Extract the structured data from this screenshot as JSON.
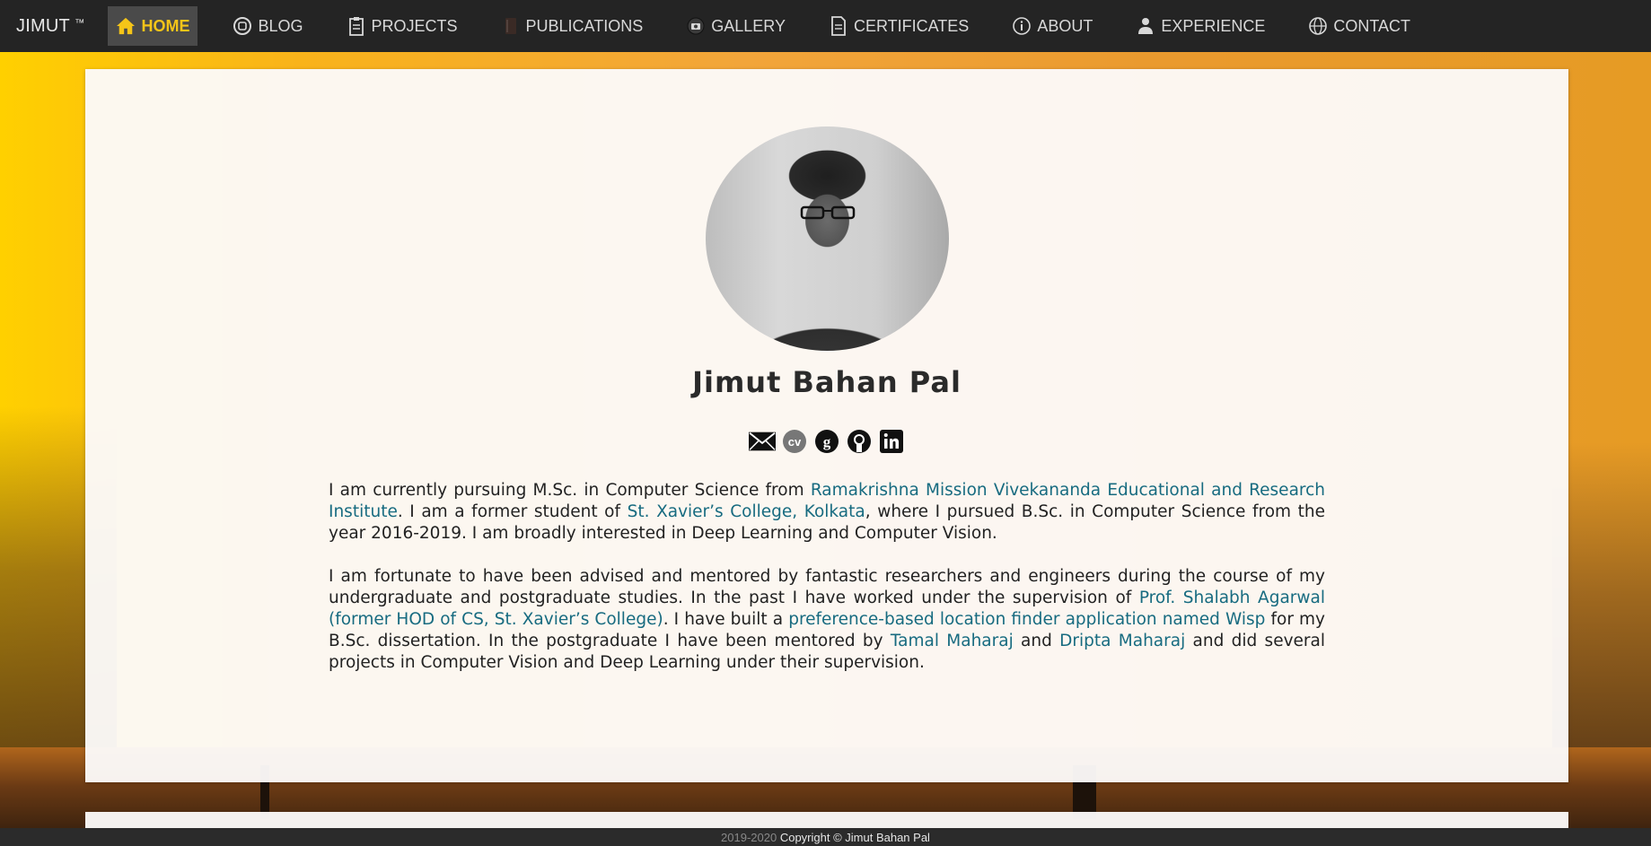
{
  "nav": {
    "brand": "JIMUT",
    "brand_tm": "™",
    "items": [
      {
        "label": "HOME",
        "icon": "home-icon",
        "active": true
      },
      {
        "label": "BLOG",
        "icon": "blogger-icon"
      },
      {
        "label": "PROJECTS",
        "icon": "clipboard-icon"
      },
      {
        "label": "PUBLICATIONS",
        "icon": "book-icon"
      },
      {
        "label": "GALLERY",
        "icon": "camera-icon"
      },
      {
        "label": "CERTIFICATES",
        "icon": "document-icon"
      },
      {
        "label": "ABOUT",
        "icon": "info-icon"
      },
      {
        "label": "EXPERIENCE",
        "icon": "person-icon"
      },
      {
        "label": "CONTACT",
        "icon": "globe-icon"
      }
    ]
  },
  "profile": {
    "name": "Jimut Bahan Pal",
    "social": [
      "email-icon",
      "cv-icon",
      "google-scholar-icon",
      "github-icon",
      "linkedin-icon"
    ]
  },
  "bio": {
    "p1_a": "I am currently pursuing M.Sc. in Computer Science from ",
    "p1_link1": "Ramakrishna Mission Vivekananda Educational and Research Institute",
    "p1_b": ". I am a former student of ",
    "p1_link2": "St. Xavier’s College, Kolkata",
    "p1_c": ", where I pursued B.Sc. in Computer Science from the year 2016-2019. I am broadly interested in Deep Learning and Computer Vision.",
    "p2_a": "I am fortunate to have been advised and mentored by fantastic researchers and engineers during the course of my undergraduate and postgraduate studies. In the past I have worked under the supervision of ",
    "p2_link1": "Prof. Shalabh Agarwal (former HOD of CS, St. Xavier’s College)",
    "p2_b": ". I have built a ",
    "p2_link2": "preference-based location finder application named Wisp",
    "p2_c": " for my B.Sc. dissertation. In the postgraduate I have been mentored by ",
    "p2_link3": "Tamal Maharaj",
    "p2_d": " and ",
    "p2_link4": "Dripta Maharaj",
    "p2_e": " and did several projects in Computer Vision and Deep Learning under their supervision."
  },
  "footer": {
    "years": "2019-2020",
    "copyright": " Copyright © Jimut Bahan Pal"
  },
  "colors": {
    "accent": "#f5c518",
    "link": "#176b80",
    "navbar": "#242424"
  }
}
